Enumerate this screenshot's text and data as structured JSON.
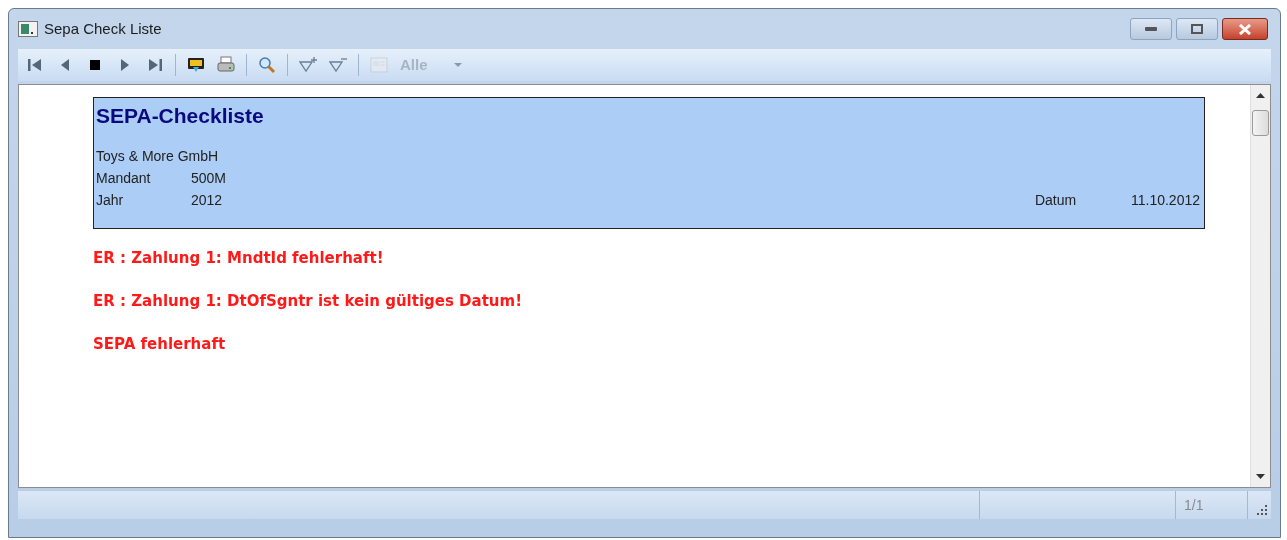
{
  "window": {
    "title": "Sepa Check Liste"
  },
  "toolbar": [
    {
      "kind": "first",
      "disabled": false
    },
    {
      "kind": "prev",
      "disabled": false
    },
    {
      "kind": "stop",
      "disabled": false
    },
    {
      "kind": "next",
      "disabled": false
    },
    {
      "kind": "last",
      "disabled": false
    },
    {
      "kind": "separator"
    },
    {
      "kind": "export",
      "disabled": false
    },
    {
      "kind": "print",
      "disabled": false
    },
    {
      "kind": "separator"
    },
    {
      "kind": "search",
      "disabled": false
    },
    {
      "kind": "separator"
    },
    {
      "kind": "filter-add",
      "disabled": false
    },
    {
      "kind": "filter-remove",
      "disabled": false
    },
    {
      "kind": "separator"
    },
    {
      "kind": "card",
      "disabled": true
    },
    {
      "kind": "dropdown",
      "value": "Alle",
      "disabled": true
    }
  ],
  "report": {
    "title": "SEPA-Checkliste",
    "company": "Toys & More GmbH",
    "fields": [
      {
        "label": "Mandant",
        "value": "500M"
      },
      {
        "label": "Jahr",
        "value": "2012"
      }
    ],
    "date": {
      "label": "Datum",
      "value": "11.10.2012"
    },
    "messages": [
      "ER : Zahlung 1: MndtId fehlerhaft!",
      "ER : Zahlung 1: DtOfSgntr ist kein gültiges Datum!",
      "SEPA fehlerhaft"
    ]
  },
  "status_bar": {
    "page": "1/1"
  }
}
